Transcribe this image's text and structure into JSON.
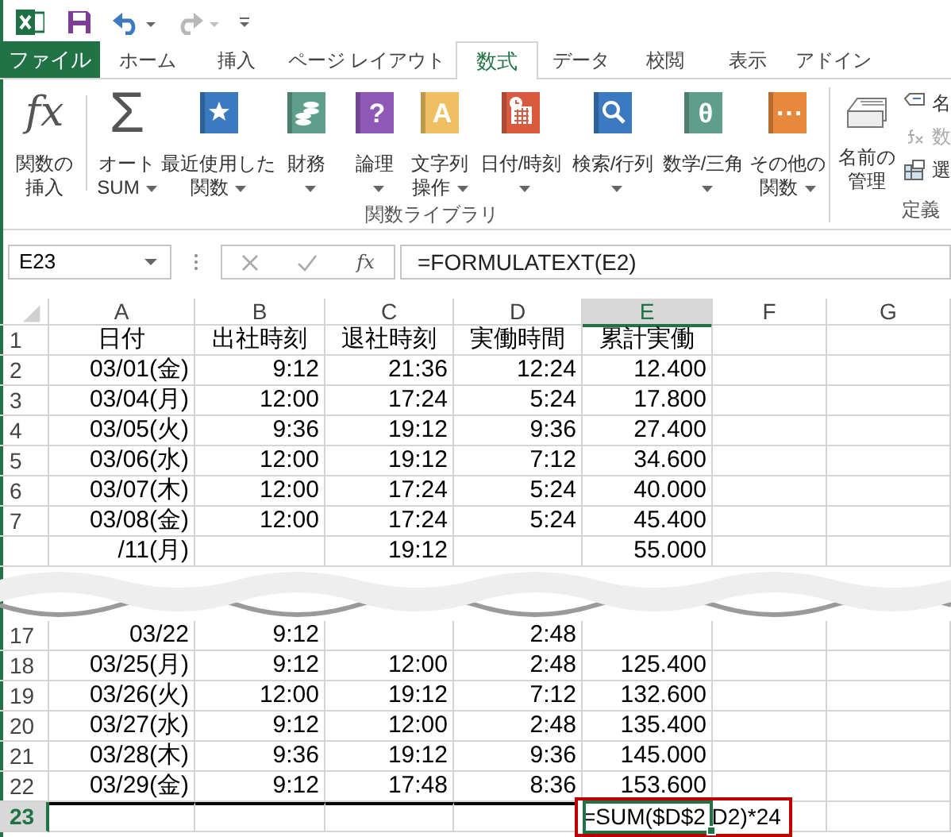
{
  "toolbar": [
    {
      "kind": "logo"
    },
    {
      "kind": "save"
    },
    {
      "kind": "undo",
      "disabled": false
    },
    {
      "kind": "redo",
      "disabled": true
    },
    {
      "kind": "customize"
    }
  ],
  "tabs": [
    {
      "label": "ファイル",
      "kind": "file",
      "selected": false
    },
    {
      "label": "ホーム",
      "kind": "tab",
      "selected": false
    },
    {
      "label": "挿入",
      "kind": "tab",
      "selected": false
    },
    {
      "label": "ページ レイアウト",
      "kind": "tab",
      "selected": false
    },
    {
      "label": "数式",
      "kind": "tab",
      "selected": true
    },
    {
      "label": "データ",
      "kind": "tab",
      "selected": false
    },
    {
      "label": "校閲",
      "kind": "tab",
      "selected": false
    },
    {
      "label": "表示",
      "kind": "tab",
      "selected": false
    },
    {
      "label": "アドイン",
      "kind": "tab",
      "selected": false
    }
  ],
  "ribbon": {
    "buttons": [
      {
        "kind": "glyph",
        "glyph": "fx",
        "lines": [
          "関数の",
          "挿入"
        ],
        "dropdown": false
      },
      {
        "kind": "glyph",
        "glyph": "Σ",
        "lines": [
          "オート",
          "SUM"
        ],
        "dropdown": true
      },
      {
        "kind": "star_book",
        "color": "#3b79c0",
        "lines": [
          "最近使用した",
          "関数"
        ],
        "dropdown": true
      },
      {
        "kind": "coins_book",
        "color": "#5f9e8a",
        "lines": [
          "財務"
        ],
        "dropdown": true
      },
      {
        "kind": "book",
        "color": "#8e59b6",
        "glyph": "?",
        "lines": [
          "論理"
        ],
        "dropdown": true
      },
      {
        "kind": "book",
        "color": "#efbf62",
        "glyph": "A",
        "lines": [
          "文字列",
          "操作"
        ],
        "dropdown": true
      },
      {
        "kind": "calendar_book",
        "color": "#d95b3f",
        "lines": [
          "日付/時刻"
        ],
        "dropdown": true
      },
      {
        "kind": "magnifier_book",
        "color": "#3b79c0",
        "lines": [
          "検索/行列"
        ],
        "dropdown": true
      },
      {
        "kind": "book",
        "color": "#5f9e8a",
        "glyph": "θ",
        "lines": [
          "数学/三角"
        ],
        "dropdown": true
      },
      {
        "kind": "book",
        "color": "#e8883b",
        "glyph": "···",
        "lines": [
          "その他の",
          "関数"
        ],
        "dropdown": true
      }
    ],
    "group_label": "関数ライブラリ",
    "name_manager": {
      "lines": [
        "名前の",
        "管理"
      ]
    },
    "small_items": [
      {
        "kind": "tag",
        "text": "名",
        "disabled": false
      },
      {
        "kind": "fx",
        "text": "数",
        "disabled": true
      },
      {
        "kind": "table",
        "text": "選",
        "disabled": false
      }
    ],
    "group2_label": "定義"
  },
  "formula_bar": {
    "name_box": "E23",
    "fx": "fx",
    "formula": "=FORMULATEXT(E2)"
  },
  "columns": [
    {
      "label": "A",
      "selected": false
    },
    {
      "label": "B",
      "selected": false
    },
    {
      "label": "C",
      "selected": false
    },
    {
      "label": "D",
      "selected": false
    },
    {
      "label": "E",
      "selected": true
    },
    {
      "label": "F",
      "selected": false
    },
    {
      "label": "G",
      "selected": false
    }
  ],
  "rows": [
    {
      "kind": "header",
      "number": "1",
      "selected": false,
      "cells": [
        "日付",
        "出社時刻",
        "退社時刻",
        "実働時間",
        "累計実働"
      ]
    },
    {
      "kind": "data",
      "number": "2",
      "selected": false,
      "cells": [
        "03/01(金)",
        "9:12",
        "21:36",
        "12:24",
        "12.400"
      ]
    },
    {
      "kind": "data",
      "number": "3",
      "selected": false,
      "cells": [
        "03/04(月)",
        "12:00",
        "17:24",
        "5:24",
        "17.800"
      ]
    },
    {
      "kind": "data",
      "number": "4",
      "selected": false,
      "cells": [
        "03/05(火)",
        "9:36",
        "19:12",
        "9:36",
        "27.400"
      ]
    },
    {
      "kind": "data",
      "number": "5",
      "selected": false,
      "cells": [
        "03/06(水)",
        "12:00",
        "19:12",
        "7:12",
        "34.600"
      ]
    },
    {
      "kind": "data",
      "number": "6",
      "selected": false,
      "cells": [
        "03/07(木)",
        "12:00",
        "17:24",
        "5:24",
        "40.000"
      ]
    },
    {
      "kind": "data",
      "number": "7",
      "selected": false,
      "cells": [
        "03/08(金)",
        "12:00",
        "17:24",
        "5:24",
        "45.400"
      ]
    },
    {
      "kind": "data",
      "selected": false,
      "cells": [
        "/11(月)",
        null,
        "19:12",
        null,
        "55.000"
      ]
    },
    {
      "kind": "tear"
    },
    {
      "kind": "data",
      "number": "17",
      "selected": false,
      "cells": [
        "03/22",
        "9:12",
        null,
        "2:48",
        null
      ]
    },
    {
      "kind": "data",
      "number": "18",
      "selected": false,
      "cells": [
        "03/25(月)",
        "9:12",
        "12:00",
        "2:48",
        "125.400"
      ]
    },
    {
      "kind": "data",
      "number": "19",
      "selected": false,
      "cells": [
        "03/26(火)",
        "12:00",
        "19:12",
        "7:12",
        "132.600"
      ]
    },
    {
      "kind": "data",
      "number": "20",
      "selected": false,
      "cells": [
        "03/27(水)",
        "9:12",
        "12:00",
        "2:48",
        "135.400"
      ]
    },
    {
      "kind": "data",
      "number": "21",
      "selected": false,
      "cells": [
        "03/28(木)",
        "9:36",
        "19:12",
        "9:36",
        "145.000"
      ]
    },
    {
      "kind": "data",
      "number": "22",
      "selected": false,
      "cells": [
        "03/29(金)",
        "9:12",
        "17:48",
        "8:36",
        "153.600"
      ]
    },
    {
      "kind": "data",
      "number": "23",
      "selected": true,
      "cells": [],
      "callout": "=SUM($D$2 D2)*24"
    }
  ]
}
